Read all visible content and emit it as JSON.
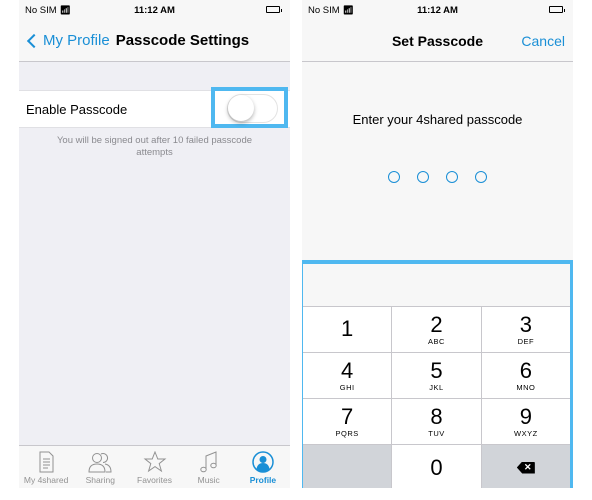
{
  "left": {
    "status": {
      "carrier": "No SIM",
      "time": "11:12 AM"
    },
    "nav": {
      "back_label": "My Profile",
      "title": "Passcode Settings"
    },
    "setting": {
      "label": "Enable Passcode",
      "toggle_on": false
    },
    "footnote": "You will be signed out after 10 failed passcode attempts",
    "tabs": [
      {
        "label": "My 4shared",
        "icon": "document-icon",
        "active": false
      },
      {
        "label": "Sharing",
        "icon": "users-icon",
        "active": false
      },
      {
        "label": "Favorites",
        "icon": "star-icon",
        "active": false
      },
      {
        "label": "Music",
        "icon": "music-note-icon",
        "active": false
      },
      {
        "label": "Profile",
        "icon": "profile-icon",
        "active": true
      }
    ]
  },
  "right": {
    "status": {
      "carrier": "No SIM",
      "time": "11:12 AM"
    },
    "nav": {
      "title": "Set Passcode",
      "cancel_label": "Cancel"
    },
    "prompt": "Enter your 4shared passcode",
    "passcode_length": 4,
    "passcode_entered": 0,
    "keys": [
      {
        "num": "1",
        "letters": ""
      },
      {
        "num": "2",
        "letters": "ABC"
      },
      {
        "num": "3",
        "letters": "DEF"
      },
      {
        "num": "4",
        "letters": "GHI"
      },
      {
        "num": "5",
        "letters": "JKL"
      },
      {
        "num": "6",
        "letters": "MNO"
      },
      {
        "num": "7",
        "letters": "PQRS"
      },
      {
        "num": "8",
        "letters": "TUV"
      },
      {
        "num": "9",
        "letters": "WXYZ"
      },
      {
        "num": "",
        "letters": ""
      },
      {
        "num": "0",
        "letters": ""
      },
      {
        "num": "",
        "letters": "",
        "icon": "backspace-icon"
      }
    ]
  },
  "colors": {
    "accent": "#1a8fd6",
    "highlight": "#4fb8f0"
  }
}
